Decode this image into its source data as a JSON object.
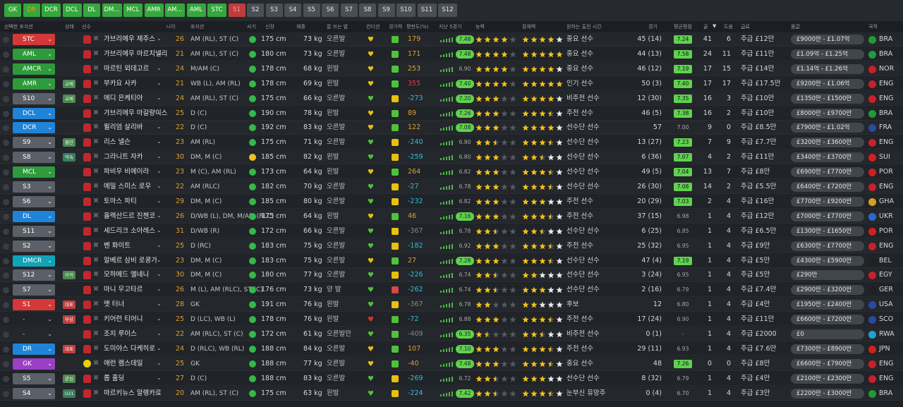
{
  "tabs": [
    {
      "label": "GK",
      "style": "g"
    },
    {
      "label": "DR",
      "style": "dr"
    },
    {
      "label": "DCR",
      "style": "g"
    },
    {
      "label": "DCL",
      "style": "g"
    },
    {
      "label": "DL",
      "style": "g"
    },
    {
      "label": "DM...",
      "style": "g"
    },
    {
      "label": "MCL",
      "style": "g"
    },
    {
      "label": "AMR",
      "style": "g"
    },
    {
      "label": "AM...",
      "style": "g"
    },
    {
      "label": "AML",
      "style": "g"
    },
    {
      "label": "STC",
      "style": "g"
    },
    {
      "label": "S1",
      "style": "red"
    },
    {
      "label": "S2",
      "style": ""
    },
    {
      "label": "S3",
      "style": ""
    },
    {
      "label": "S4",
      "style": ""
    },
    {
      "label": "S5",
      "style": ""
    },
    {
      "label": "S6",
      "style": ""
    },
    {
      "label": "S7",
      "style": ""
    },
    {
      "label": "S8",
      "style": ""
    },
    {
      "label": "S9",
      "style": ""
    },
    {
      "label": "S10",
      "style": ""
    },
    {
      "label": "S11",
      "style": ""
    },
    {
      "label": "S12",
      "style": ""
    }
  ],
  "headers": {
    "pos": "선택한 포지션",
    "status": "상태",
    "player": "선수",
    "age": "나이",
    "position": "포지션",
    "morale": "사기",
    "height": "신장",
    "weight": "체중",
    "foot": "잘 쓰는 발",
    "condition": "컨디션",
    "fitness": "경기력",
    "reputation": "평판도(%)",
    "last5": "지난 5경기",
    "ability": "능력",
    "potential": "잠재력",
    "playing_time": "원하는 출전 시간",
    "apps": "경기",
    "avg": "평균평점",
    "goals": "골",
    "assists": "도움",
    "wage": "급료",
    "value": "몸값",
    "nation": "국적"
  },
  "players": [
    {
      "sel": "STC",
      "sc": "pr",
      "badge": "",
      "bc": "",
      "name": "가브리에우 제주스",
      "age": "26",
      "pos": "AM (RL), ST (C)",
      "m": "g",
      "ht": "175 cm",
      "wt": "73 kg",
      "ft": "오른발",
      "cond": "y",
      "gi": "g",
      "rep": "179",
      "rc": "pos-num",
      "rating": "7.48",
      "rp": "g",
      "ab": 4,
      "pt": 4,
      "role": "중요 선수",
      "apps": "45 (14)",
      "avg": "7.24",
      "ac": "g",
      "goals": "41",
      "ast": "6",
      "wage": "주급 £12만",
      "val": "£9000만 - £1.07억",
      "nat": "BRA",
      "fl": "#1f9b3a"
    },
    {
      "sel": "AML",
      "sc": "pg",
      "badge": "",
      "bc": "",
      "name": "가브리에우 마르치넬리",
      "age": "21",
      "pos": "AM (RL), ST (C)",
      "m": "g",
      "ht": "180 cm",
      "wt": "73 kg",
      "ft": "오른발",
      "cond": "y",
      "gi": "g",
      "rep": "171",
      "rc": "pos-num",
      "rating": "7.48",
      "rp": "g",
      "ab": 4,
      "pt": 5,
      "role": "중요 선수",
      "apps": "44 (13)",
      "avg": "7.58",
      "ac": "g",
      "goals": "24",
      "ast": "11",
      "wage": "주급 £11만",
      "val": "£1.09억 - £1.25억",
      "nat": "BRA",
      "fl": "#1f9b3a"
    },
    {
      "sel": "AMCR",
      "sc": "pg",
      "badge": "",
      "bc": "",
      "name": "마르틴 외데고르",
      "age": "24",
      "pos": "M/AM (C)",
      "m": "g",
      "ht": "178 cm",
      "wt": "68 kg",
      "ft": "왼발",
      "cond": "y",
      "gi": "g",
      "rep": "253",
      "rc": "pos-num",
      "rating": "6.90",
      "rp": "d",
      "ab": 4,
      "pt": 4,
      "role": "중요 선수",
      "apps": "46 (12)",
      "avg": "7.19",
      "ac": "g",
      "goals": "17",
      "ast": "15",
      "wage": "주급 £14만",
      "val": "£1.14억 - £1.26억",
      "nat": "NOR",
      "fl": "#c8202c"
    },
    {
      "sel": "AMR",
      "sc": "pg",
      "badge": "교체",
      "bc": "bg",
      "name": "부카요 사카",
      "age": "21",
      "pos": "WB (L), AM (RL)",
      "m": "g",
      "ht": "178 cm",
      "wt": "69 kg",
      "ft": "왼발",
      "cond": "y",
      "gi": "g",
      "rep": "355",
      "rc": "negred",
      "rating": "7.40",
      "rp": "g",
      "ab": 4,
      "pt": 5,
      "role": "인기 선수",
      "apps": "50 (3)",
      "avg": "7.40",
      "ac": "g",
      "goals": "17",
      "ast": "17",
      "wage": "주급 £17.5만",
      "val": "£9200만 - £1.06억",
      "nat": "ENG",
      "fl": "#c8202c"
    },
    {
      "sel": "S10",
      "sc": "ps",
      "badge": "교체",
      "bc": "bg",
      "name": "에디 은케티아",
      "age": "24",
      "pos": "AM (RL), ST (C)",
      "m": "g",
      "ht": "175 cm",
      "wt": "66 kg",
      "ft": "오른발",
      "cond": "g",
      "gi": "y",
      "rep": "-273",
      "rc": "neg",
      "rating": "7.20",
      "rp": "g",
      "ab": 3,
      "pt": 4,
      "role": "비주전 선수",
      "apps": "12 (30)",
      "avg": "7.35",
      "ac": "g",
      "goals": "16",
      "ast": "3",
      "wage": "주급 £10만",
      "val": "£1350만 - £1500만",
      "nat": "ENG",
      "fl": "#c8202c"
    },
    {
      "sel": "DCL",
      "sc": "pb",
      "badge": "",
      "bc": "",
      "name": "가브리에우 마갈량이스",
      "age": "25",
      "pos": "D (C)",
      "m": "g",
      "ht": "190 cm",
      "wt": "78 kg",
      "ft": "왼발",
      "cond": "y",
      "gi": "g",
      "rep": "89",
      "rc": "pos-num",
      "rating": "7.26",
      "rp": "g",
      "ab": 3,
      "pt": 3.5,
      "role": "주전 선수",
      "apps": "46 (5)",
      "avg": "7.38",
      "ac": "g",
      "goals": "16",
      "ast": "2",
      "wage": "주급 £10만",
      "val": "£8000만 - £9700만",
      "nat": "BRA",
      "fl": "#1f9b3a"
    },
    {
      "sel": "DCR",
      "sc": "pb",
      "badge": "",
      "bc": "",
      "name": "윌리엄 살리바",
      "age": "22",
      "pos": "D (C)",
      "m": "g",
      "ht": "192 cm",
      "wt": "83 kg",
      "ft": "오른발",
      "cond": "y",
      "gi": "g",
      "rep": "122",
      "rc": "pos-num",
      "rating": "7.08",
      "rp": "g",
      "ab": 3,
      "pt": 4,
      "role": "선수단 선수",
      "apps": "57",
      "avg": "7.00",
      "ac": "d",
      "goals": "9",
      "ast": "0",
      "wage": "주급 £8.5만",
      "val": "£7900만 - £1.02억",
      "nat": "FRA",
      "fl": "#2a4aa0"
    },
    {
      "sel": "S9",
      "sc": "ps",
      "badge": "불만",
      "bc": "bg",
      "name": "리스 넬슨",
      "age": "23",
      "pos": "AM (RL)",
      "m": "g",
      "ht": "175 cm",
      "wt": "71 kg",
      "ft": "오른발",
      "cond": "g",
      "gi": "y",
      "rep": "-240",
      "rc": "neg",
      "rating": "6.80",
      "rp": "d",
      "ab": 2.5,
      "pt": 3.5,
      "role": "선수단 선수",
      "apps": "13 (27)",
      "avg": "7.23",
      "ac": "g",
      "goals": "7",
      "ast": "9",
      "wage": "주급 £7.7만",
      "val": "£3200만 - £3600만",
      "nat": "ENG",
      "fl": "#c8202c"
    },
    {
      "sel": "S8",
      "sc": "ps",
      "badge": "약속",
      "bc": "bt",
      "name": "그라니트 자카",
      "age": "30",
      "pos": "DM, M (C)",
      "m": "ye",
      "ht": "185 cm",
      "wt": "82 kg",
      "ft": "왼발",
      "cond": "g",
      "gi": "y",
      "rep": "-259",
      "rc": "neg",
      "rating": "6.80",
      "rp": "d",
      "ab": 3,
      "pt": 2.5,
      "role": "선수단 선수",
      "apps": "6 (36)",
      "avg": "7.07",
      "ac": "g",
      "goals": "4",
      "ast": "2",
      "wage": "주급 £11만",
      "val": "£3400만 - £3700만",
      "nat": "SUI",
      "fl": "#d02020"
    },
    {
      "sel": "MCL",
      "sc": "pg",
      "badge": "",
      "bc": "",
      "name": "파비우 비에이라",
      "age": "23",
      "pos": "M (C), AM (RL)",
      "m": "g",
      "ht": "173 cm",
      "wt": "64 kg",
      "ft": "왼발",
      "cond": "y",
      "gi": "g",
      "rep": "264",
      "rc": "pos-num",
      "rating": "6.82",
      "rp": "d",
      "ab": 3,
      "pt": 3.5,
      "role": "선수단 선수",
      "apps": "49 (5)",
      "avg": "7.04",
      "ac": "g",
      "goals": "13",
      "ast": "7",
      "wage": "주급 £8만",
      "val": "£6900만 - £7700만",
      "nat": "POR",
      "fl": "#d02020"
    },
    {
      "sel": "S3",
      "sc": "ps",
      "badge": "",
      "bc": "",
      "name": "에밀 스미스 로우",
      "age": "22",
      "pos": "AM (RLC)",
      "m": "g",
      "ht": "182 cm",
      "wt": "70 kg",
      "ft": "오른발",
      "cond": "g",
      "gi": "y",
      "rep": "-27",
      "rc": "neg",
      "rating": "6.78",
      "rp": "d",
      "ab": 3,
      "pt": 3.5,
      "role": "선수단 선수",
      "apps": "26 (30)",
      "avg": "7.08",
      "ac": "g",
      "goals": "14",
      "ast": "2",
      "wage": "주급 £5.5만",
      "val": "£6400만 - £7200만",
      "nat": "ENG",
      "fl": "#c8202c"
    },
    {
      "sel": "S6",
      "sc": "ps",
      "badge": "",
      "bc": "",
      "name": "토마스 파티",
      "age": "29",
      "pos": "DM, M (C)",
      "m": "g",
      "ht": "185 cm",
      "wt": "80 kg",
      "ft": "오른발",
      "cond": "g",
      "gi": "y",
      "rep": "-232",
      "rc": "neg",
      "rating": "6.82",
      "rp": "d",
      "ab": 3,
      "pt": 3,
      "role": "주전 선수",
      "apps": "20 (29)",
      "avg": "7.03",
      "ac": "g",
      "goals": "2",
      "ast": "4",
      "wage": "주급 £16만",
      "val": "£7700만 - £9200만",
      "nat": "GHA",
      "fl": "#d8a020"
    },
    {
      "sel": "DL",
      "sc": "pb",
      "badge": "",
      "bc": "",
      "name": "올렉산드르 진첸코",
      "age": "26",
      "pos": "D/WB (L), DM, M/AM (RLC)",
      "m": "g",
      "ht": "175 cm",
      "wt": "64 kg",
      "ft": "왼발",
      "cond": "y",
      "gi": "g",
      "rep": "46",
      "rc": "pos-num",
      "rating": "7.16",
      "rp": "g",
      "ab": 3,
      "pt": 3.5,
      "role": "주전 선수",
      "apps": "37 (15)",
      "avg": "6.98",
      "ac": "d",
      "goals": "1",
      "ast": "4",
      "wage": "주급 £12만",
      "val": "£7000만 - £7700만",
      "nat": "UKR",
      "fl": "#2a6ad0"
    },
    {
      "sel": "S11",
      "sc": "ps",
      "badge": "",
      "bc": "",
      "name": "세드리크 소아레스",
      "age": "31",
      "pos": "D/WB (R)",
      "m": "g",
      "ht": "172 cm",
      "wt": "66 kg",
      "ft": "오른발",
      "cond": "g",
      "gi": "y",
      "rep": "-367",
      "rc": "txtdim",
      "rating": "6.78",
      "rp": "d",
      "ab": 2.5,
      "pt": 2.5,
      "role": "선수단 선수",
      "apps": "6 (25)",
      "avg": "6.85",
      "ac": "d",
      "goals": "1",
      "ast": "4",
      "wage": "주급 £6.5만",
      "val": "£1300만 - £1650만",
      "nat": "POR",
      "fl": "#d02020"
    },
    {
      "sel": "S2",
      "sc": "ps",
      "badge": "",
      "bc": "",
      "name": "벤 화이트",
      "age": "25",
      "pos": "D (RC)",
      "m": "g",
      "ht": "183 cm",
      "wt": "75 kg",
      "ft": "오른발",
      "cond": "g",
      "gi": "y",
      "rep": "-182",
      "rc": "neg",
      "rating": "6.92",
      "rp": "d",
      "ab": 3,
      "pt": 3.5,
      "role": "주전 선수",
      "apps": "25 (32)",
      "avg": "6.95",
      "ac": "d",
      "goals": "1",
      "ast": "4",
      "wage": "주급 £9만",
      "val": "£6300만 - £7700만",
      "nat": "ENG",
      "fl": "#c8202c"
    },
    {
      "sel": "DMCR",
      "sc": "pt",
      "badge": "",
      "bc": "",
      "name": "알베르 삼비 로콩가",
      "age": "23",
      "pos": "DM, M (C)",
      "m": "g",
      "ht": "183 cm",
      "wt": "75 kg",
      "ft": "오른발",
      "cond": "y",
      "gi": "g",
      "rep": "27",
      "rc": "pos-num",
      "rating": "7.28",
      "rp": "g",
      "ab": 3,
      "pt": 3.5,
      "role": "선수단 선수",
      "apps": "47 (4)",
      "avg": "7.19",
      "ac": "g",
      "goals": "1",
      "ast": "4",
      "wage": "주급 £5만",
      "val": "£4300만 - £5900만",
      "nat": "BEL",
      "fl": "#202020"
    },
    {
      "sel": "S12",
      "sc": "ps",
      "badge": "이적",
      "bc": "bg",
      "name": "모하메드 엘네니",
      "age": "30",
      "pos": "DM, M (C)",
      "m": "g",
      "ht": "180 cm",
      "wt": "77 kg",
      "ft": "오른발",
      "cond": "g",
      "gi": "y",
      "rep": "-226",
      "rc": "neg",
      "rating": "6.74",
      "rp": "d",
      "ab": 2.5,
      "pt": 2,
      "role": "선수단 선수",
      "apps": "3 (24)",
      "avg": "6.95",
      "ac": "d",
      "goals": "1",
      "ast": "4",
      "wage": "주급 £5만",
      "val": "£290만",
      "nat": "EGY",
      "fl": "#c8202c"
    },
    {
      "sel": "S7",
      "sc": "ps",
      "badge": "",
      "bc": "",
      "name": "마니 무고타르",
      "age": "26",
      "pos": "M (L), AM (RLC), ST (C)",
      "m": "g",
      "ht": "176 cm",
      "wt": "73 kg",
      "ft": "양 발",
      "cond": "g",
      "gi": "r",
      "rep": "-262",
      "rc": "neg",
      "rating": "6.74",
      "rp": "d",
      "ab": 2.5,
      "pt": 3,
      "role": "선수단 선수",
      "apps": "2 (16)",
      "avg": "6.79",
      "ac": "d",
      "goals": "1",
      "ast": "4",
      "wage": "주급 £7.4만",
      "val": "£2900만 - £3200만",
      "nat": "GER",
      "fl": "#202020"
    },
    {
      "sel": "S1",
      "sc": "pr",
      "badge": "대표",
      "bc": "brd",
      "name": "맷 터너",
      "age": "28",
      "pos": "GK",
      "m": "g",
      "ht": "191 cm",
      "wt": "76 kg",
      "ft": "왼발",
      "cond": "g",
      "gi": "y",
      "rep": "-367",
      "rc": "txtdim",
      "rating": "6.78",
      "rp": "d",
      "ab": 2,
      "pt": 2,
      "role": "후보",
      "apps": "12",
      "avg": "6.80",
      "ac": "d",
      "goals": "1",
      "ast": "4",
      "wage": "주급 £4만",
      "val": "£1950만 - £2400만",
      "nat": "USA",
      "fl": "#2a4aa0"
    },
    {
      "sel": "-",
      "sc": "pn",
      "badge": "부상",
      "bc": "brd",
      "name": "키어런 티어니",
      "age": "25",
      "pos": "D (LC), WB (L)",
      "m": "g",
      "ht": "178 cm",
      "wt": "76 kg",
      "ft": "왼발",
      "cond": "r",
      "gi": "g",
      "rep": "-72",
      "rc": "neg",
      "rating": "6.88",
      "rp": "d",
      "ab": 3,
      "pt": 3.5,
      "role": "주전 선수",
      "apps": "17 (24)",
      "avg": "6.90",
      "ac": "d",
      "goals": "1",
      "ast": "4",
      "wage": "주급 £11만",
      "val": "£6600만 - £7200만",
      "nat": "SCO",
      "fl": "#2a4aa0"
    },
    {
      "sel": "-",
      "sc": "pn",
      "badge": "",
      "bc": "",
      "name": "조지 루이스",
      "age": "22",
      "pos": "AM (RLC), ST (C)",
      "m": "g",
      "ht": "172 cm",
      "wt": "61 kg",
      "ft": "오른발만",
      "cond": "g",
      "gi": "g",
      "rep": "-409",
      "rc": "txtdim",
      "rating": "6.35",
      "rp": "g",
      "ab": 1.5,
      "pt": 2.5,
      "role": "비주전 선수",
      "apps": "0 (1)",
      "avg": "-",
      "ac": "d",
      "goals": "1",
      "ast": "4",
      "wage": "주급 £2000",
      "val": "£0",
      "nat": "RWA",
      "fl": "#20a0d0"
    },
    {
      "sel": "DR",
      "sc": "pb",
      "badge": "대표",
      "bc": "brd",
      "name": "도미야스 다케히로",
      "age": "24",
      "pos": "D (RLC), WB (RL)",
      "m": "g",
      "ht": "188 cm",
      "wt": "84 kg",
      "ft": "오른발",
      "cond": "y",
      "gi": "g",
      "rep": "107",
      "rc": "pos-num",
      "rating": "7.10",
      "rp": "g",
      "ab": 3,
      "pt": 3.5,
      "role": "주전 선수",
      "apps": "29 (11)",
      "avg": "6.93",
      "ac": "d",
      "goals": "1",
      "ast": "4",
      "wage": "주급 £7.6만",
      "val": "£7300만 - £8900만",
      "nat": "JPN",
      "fl": "#d02020"
    },
    {
      "sel": "GK",
      "sc": "pp",
      "badge": "",
      "bc": "",
      "name": "애런 램스데일",
      "age": "25",
      "pos": "GK",
      "m": "g",
      "ht": "188 cm",
      "wt": "77 kg",
      "ft": "오른발",
      "cond": "y",
      "gi": "g",
      "rep": "-40",
      "rc": "pos-num",
      "rating": "7.48",
      "rp": "g",
      "ab": 3,
      "pt": 3.5,
      "role": "중요 선수",
      "apps": "48",
      "avg": "7.26",
      "ac": "g",
      "goals": "0",
      "ast": "0",
      "wage": "주급 £8만",
      "val": "£6600만 - £7900만",
      "nat": "ENG",
      "fl": "#c8202c",
      "gk": true
    },
    {
      "sel": "S5",
      "sc": "ps",
      "badge": "관심",
      "bc": "bg",
      "name": "롭 홀딩",
      "age": "27",
      "pos": "D (C)",
      "m": "g",
      "ht": "188 cm",
      "wt": "83 kg",
      "ft": "오른발",
      "cond": "g",
      "gi": "y",
      "rep": "-269",
      "rc": "neg",
      "rating": "6.72",
      "rp": "d",
      "ab": 2.5,
      "pt": 3,
      "role": "선수단 선수",
      "apps": "8 (32)",
      "avg": "6.79",
      "ac": "d",
      "goals": "1",
      "ast": "4",
      "wage": "주급 £4만",
      "val": "£2100만 - £2300만",
      "nat": "ENG",
      "fl": "#c8202c"
    },
    {
      "sel": "S4",
      "sc": "ps",
      "badge": "U21",
      "bc": "bt",
      "name": "마르키뉴스 알렝카르",
      "age": "20",
      "pos": "AM (RL), ST (C)",
      "m": "g",
      "ht": "175 cm",
      "wt": "63 kg",
      "ft": "왼발",
      "cond": "g",
      "gi": "y",
      "rep": "-224",
      "rc": "neg",
      "rating": "7.42",
      "rp": "g",
      "ab": 2.5,
      "pt": 3.5,
      "role": "눈부신 유망주",
      "apps": "0 (4)",
      "avg": "6.70",
      "ac": "d",
      "goals": "1",
      "ast": "4",
      "wage": "주급 £3만",
      "val": "£2200만 - £3000만",
      "nat": "BRA",
      "fl": "#1f9b3a"
    }
  ]
}
